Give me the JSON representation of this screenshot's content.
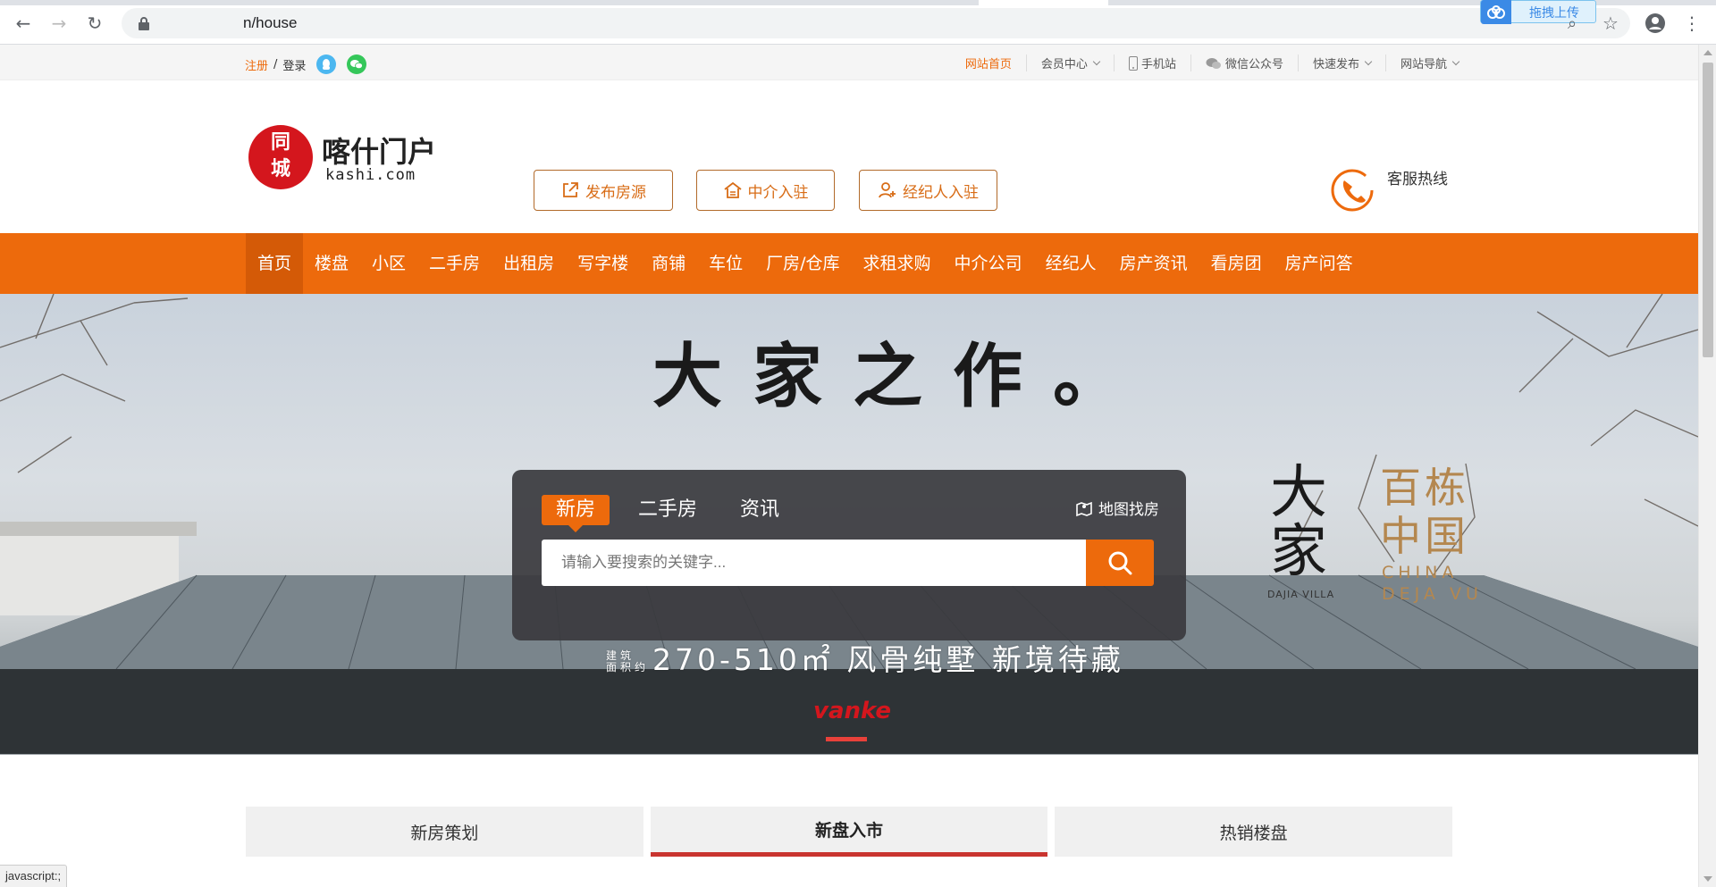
{
  "browser": {
    "url": "n/house",
    "upload_badge": "拖拽上传"
  },
  "topbar": {
    "register": "注册",
    "separator": "/",
    "login": "登录",
    "links": [
      {
        "label": "网站首页",
        "icon": ""
      },
      {
        "label": "会员中心",
        "icon": "",
        "dropdown": true
      },
      {
        "label": "手机站",
        "icon": "mobile-icon"
      },
      {
        "label": "微信公众号",
        "icon": "wechat-icon"
      },
      {
        "label": "快速发布",
        "icon": "",
        "dropdown": true
      },
      {
        "label": "网站导航",
        "icon": "",
        "dropdown": true
      }
    ]
  },
  "header": {
    "logo_char1": "同",
    "logo_char2": "城",
    "site_name": "喀什门户",
    "domain": "kashi.com",
    "buttons": [
      {
        "label": "发布房源",
        "icon": "external-edit-icon"
      },
      {
        "label": "中介入驻",
        "icon": "house-icon"
      },
      {
        "label": "经纪人入驻",
        "icon": "user-add-icon"
      }
    ],
    "hotline_label": "客服热线"
  },
  "mainnav": [
    "首页",
    "楼盘",
    "小区",
    "二手房",
    "出租房",
    "写字楼",
    "商铺",
    "车位",
    "厂房/仓库",
    "求租求购",
    "中介公司",
    "经纪人",
    "房产资讯",
    "看房团",
    "房产问答"
  ],
  "banner": {
    "slogan": "大家之作。",
    "tagline_small_1": "建筑",
    "tagline_small_2": "面积约",
    "tagline": "270-510㎡ 风骨纯墅 新境待藏",
    "brand_logo": "vanke",
    "brand1": "大家",
    "brand1_sub": "DAJIA VILLA",
    "brand2": "百栋中国",
    "brand2_sub_1": "CHINA",
    "brand2_sub_2": "DEJA VU"
  },
  "search": {
    "tabs": [
      "新房",
      "二手房",
      "资讯"
    ],
    "active_tab": "新房",
    "map_link": "地图找房",
    "placeholder": "请输入要搜索的关键字..."
  },
  "bottom_tabs": [
    "新房策划",
    "新盘入市",
    "热销楼盘"
  ],
  "bottom_active": "新盘入市",
  "statusbar": "javascript:;",
  "colors": {
    "accent": "#ed6a0c",
    "logo_red": "#d4161d",
    "tab_underline": "#c9342f"
  }
}
